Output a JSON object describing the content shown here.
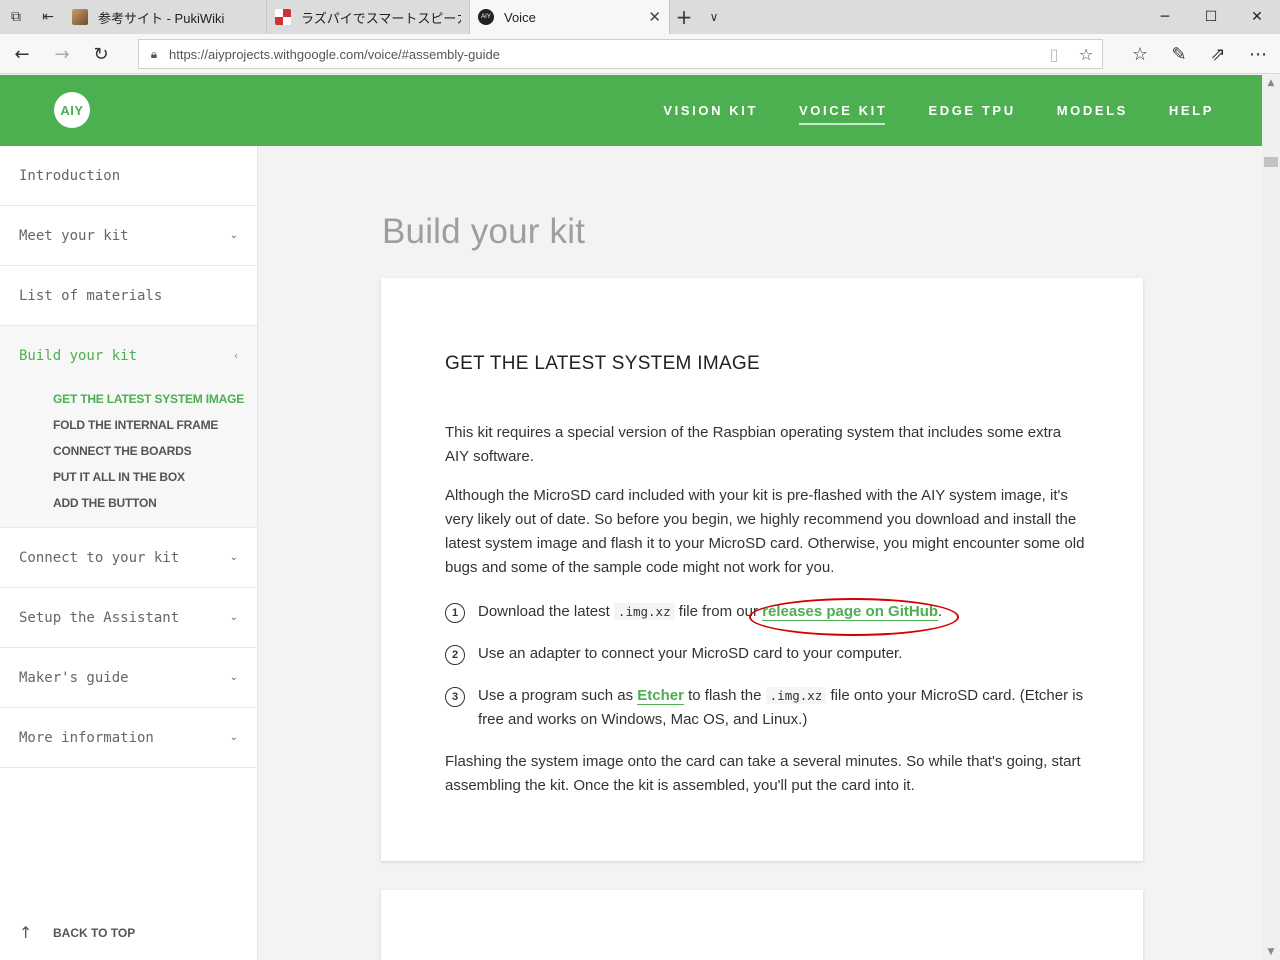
{
  "browser": {
    "tabs": [
      {
        "title": "参考サイト - PukiWiki",
        "favicon": "wiki-favicon"
      },
      {
        "title": "ラズパイでスマートスピーカーを自作",
        "favicon": "raspi-favicon"
      },
      {
        "title": "Voice",
        "favicon": "aiy-favicon",
        "active": true
      }
    ],
    "url": "https://aiyprojects.withgoogle.com/voice/#assembly-guide"
  },
  "site": {
    "logo": "AIY",
    "nav": [
      "VISION KIT",
      "VOICE KIT",
      "EDGE TPU",
      "MODELS",
      "HELP"
    ],
    "current_nav": "VOICE KIT",
    "accent_color": "#4caf50"
  },
  "sidebar": {
    "items": [
      {
        "label": "Introduction"
      },
      {
        "label": "Meet your kit"
      },
      {
        "label": "List of materials"
      },
      {
        "label": "Build your kit"
      },
      {
        "label": "Connect to your kit"
      },
      {
        "label": "Setup the Assistant"
      },
      {
        "label": "Maker's guide"
      },
      {
        "label": "More information"
      }
    ],
    "subitems": [
      "GET THE LATEST SYSTEM IMAGE",
      "FOLD THE INTERNAL FRAME",
      "CONNECT THE BOARDS",
      "PUT IT ALL IN THE BOX",
      "ADD THE BUTTON"
    ],
    "back_to_top": "BACK TO TOP"
  },
  "main": {
    "title": "Build your kit",
    "section_heading": "GET THE LATEST SYSTEM IMAGE",
    "para1": "This kit requires a special version of the Raspbian operating system that includes some extra AIY software.",
    "para2": "Although the MicroSD card included with your kit is pre-flashed with the AIY system image, it's very likely out of date. So before you begin, we highly recommend you download and install the latest system image and flash it to your MicroSD card. Otherwise, you might encounter some old bugs and some of the sample code might not work for you.",
    "step1_pre": "Download the latest ",
    "step1_code": ".img.xz",
    "step1_mid": " file from our ",
    "step1_link": "releases page on GitHub",
    "step1_post": ".",
    "step2": "Use an adapter to connect your MicroSD card to your computer.",
    "step3_pre": "Use a program such as ",
    "step3_link": "Etcher",
    "step3_mid": " to flash the ",
    "step3_code": ".img.xz",
    "step3_post": " file onto your MicroSD card. (Etcher is free and works on Windows, Mac OS, and Linux.)",
    "para3": "Flashing the system image onto the card can take a several minutes. So while that's going, start assembling the kit. Once the kit is assembled, you'll put the card into it.",
    "step_numbers": [
      "1",
      "2",
      "3"
    ]
  }
}
